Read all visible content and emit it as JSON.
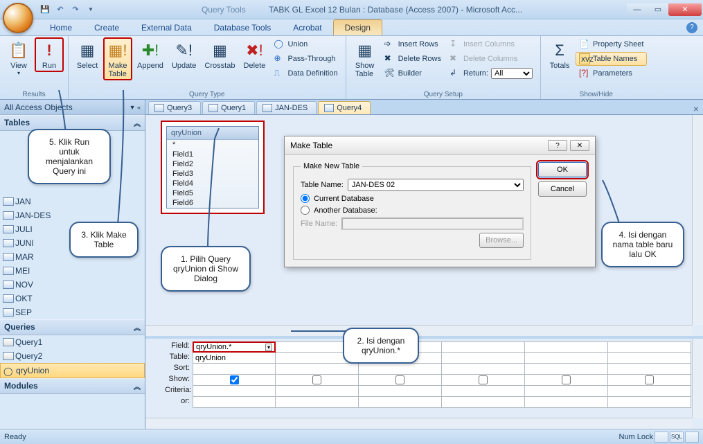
{
  "titlebar": {
    "query_tools": "Query Tools",
    "main": "TABK GL Excel 12 Bulan : Database (Access 2007)  -  Microsoft Acc..."
  },
  "ribbon_tabs": [
    "Home",
    "Create",
    "External Data",
    "Database Tools",
    "Acrobat",
    "Design"
  ],
  "ribbon": {
    "results": {
      "label": "Results",
      "view": "View",
      "run": "Run"
    },
    "query_type": {
      "label": "Query Type",
      "select": "Select",
      "make_table": "Make\nTable",
      "append": "Append",
      "update": "Update",
      "crosstab": "Crosstab",
      "delete": "Delete",
      "union": "Union",
      "pass": "Pass-Through",
      "ddl": "Data Definition"
    },
    "query_setup": {
      "label": "Query Setup",
      "show_table": "Show\nTable",
      "insert_rows": "Insert Rows",
      "delete_rows": "Delete Rows",
      "builder": "Builder",
      "insert_cols": "Insert Columns",
      "delete_cols": "Delete Columns",
      "return": "Return:",
      "return_val": "All"
    },
    "show_hide": {
      "label": "Show/Hide",
      "totals": "Totals",
      "prop_sheet": "Property Sheet",
      "table_names": "Table Names",
      "parameters": "Parameters"
    }
  },
  "navpane": {
    "header": "All Access Objects",
    "groups": {
      "tables": "Tables",
      "queries": "Queries",
      "modules": "Modules"
    },
    "tables": [
      "JAN",
      "JAN-DES",
      "JULI",
      "JUNI",
      "MAR",
      "MEI",
      "NOV",
      "OKT",
      "SEP"
    ],
    "queries": [
      "Query1",
      "Query2",
      "qryUnion"
    ]
  },
  "doc_tabs": [
    "Query3",
    "Query1",
    "JAN-DES",
    "Query4"
  ],
  "tablebox": {
    "title": "qryUnion",
    "fields": [
      "*",
      "Field1",
      "Field2",
      "Field3",
      "Field4",
      "Field5",
      "Field6"
    ]
  },
  "dialog": {
    "title": "Make Table",
    "legend": "Make New Table",
    "table_name_lbl": "Table Name:",
    "table_name_val": "JAN-DES 02",
    "current_db": "Current Database",
    "another_db": "Another Database:",
    "file_name_lbl": "File Name:",
    "browse": "Browse...",
    "ok": "OK",
    "cancel": "Cancel"
  },
  "qbe": {
    "labels": {
      "field": "Field:",
      "table": "Table:",
      "sort": "Sort:",
      "show": "Show:",
      "criteria": "Criteria:",
      "or": "or:"
    },
    "field_val": "qryUnion.*",
    "table_val": "qryUnion"
  },
  "callouts": {
    "c1": "1. Pilih Query qryUnion di Show Dialog",
    "c2": "2. Isi dengan qryUnion.*",
    "c3": "3. Klik Make Table",
    "c4": "4. Isi dengan nama table baru lalu OK",
    "c5": "5. Klik Run untuk menjalankan Query ini"
  },
  "status": {
    "ready": "Ready",
    "numlock": "Num Lock"
  }
}
